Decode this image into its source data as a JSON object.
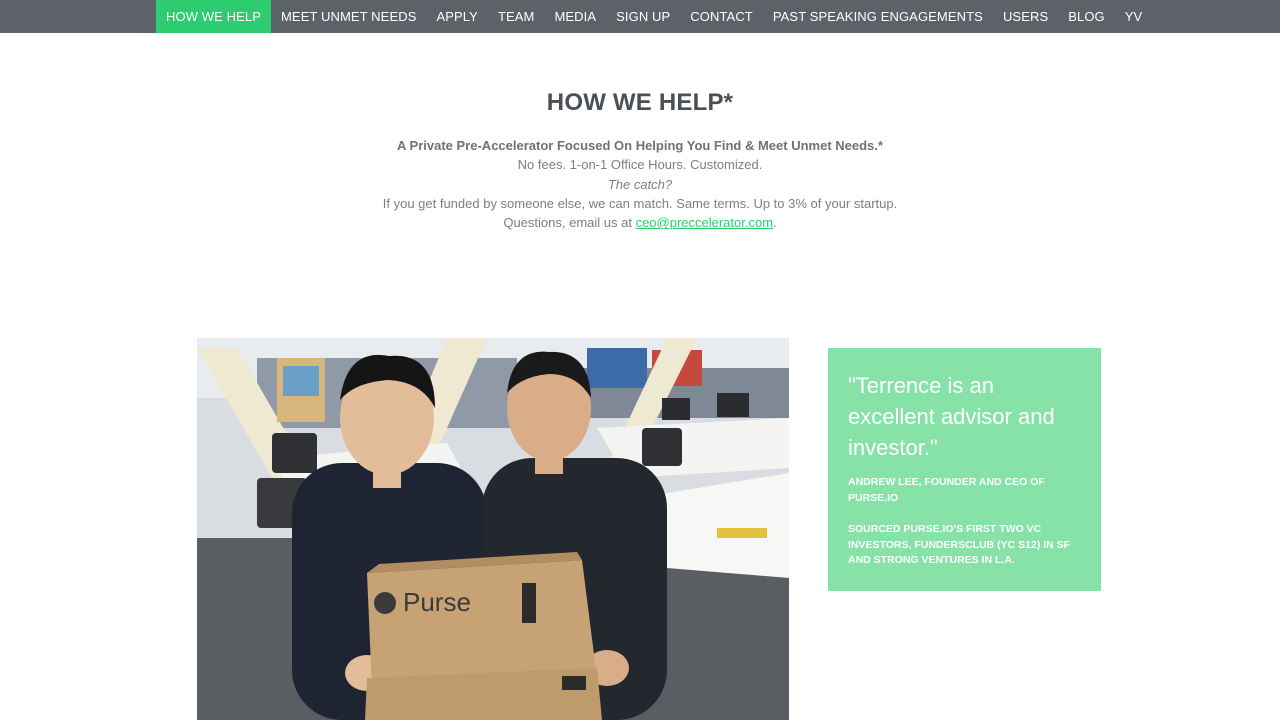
{
  "nav": {
    "items": [
      {
        "label": "HOW WE HELP",
        "active": true
      },
      {
        "label": "MEET UNMET NEEDS",
        "active": false
      },
      {
        "label": "APPLY",
        "active": false
      },
      {
        "label": "TEAM",
        "active": false
      },
      {
        "label": "MEDIA",
        "active": false
      },
      {
        "label": "SIGN UP",
        "active": false
      },
      {
        "label": "CONTACT",
        "active": false
      },
      {
        "label": "PAST SPEAKING ENGAGEMENTS",
        "active": false
      },
      {
        "label": "USERS",
        "active": false
      },
      {
        "label": "BLOG",
        "active": false
      },
      {
        "label": "YV",
        "active": false
      }
    ],
    "active_color": "#2ecc71",
    "bar_color": "#5d6168"
  },
  "hero": {
    "title": "HOW WE HELP*"
  },
  "intro": {
    "tagline": "A Private Pre-Accelerator Focused On Helping You Find & Meet Unmet Needs.*",
    "line1": "No fees. 1-on-1 Office Hours. Customized.",
    "line2": "The catch?",
    "line3": "If you get funded by someone else, we can match. Same terms. Up to 3% of your startup.",
    "contact_prefix": "Questions, email us at ",
    "contact_email": "ceo@preccelerator.com",
    "contact_suffix": "."
  },
  "testimonial": {
    "quote": "\"Terrence is an excellent advisor and investor.\"",
    "attribution": "ANDREW LEE, FOUNDER AND CEO OF PURSE.IO",
    "note": "SOURCED PURSE.IO'S FIRST TWO VC INVESTORS, FUNDERSCLUB (YC S12) IN SF AND STRONG VENTURES IN L.A.",
    "card_color": "#86e2a7"
  },
  "photo": {
    "box_label": "Purse"
  }
}
